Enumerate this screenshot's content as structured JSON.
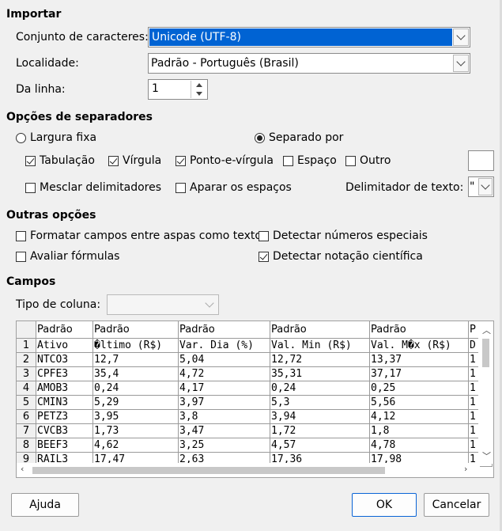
{
  "import": {
    "title": "Importar",
    "charset_label": "Conjunto de caracteres:",
    "charset_value": "Unicode (UTF-8)",
    "locale_label": "Localidade:",
    "locale_value": "Padrão - Português (Brasil)",
    "from_row_label": "Da linha:",
    "from_row_value": "1"
  },
  "separators": {
    "title": "Opções de separadores",
    "fixed_width": "Largura fixa",
    "separated_by": "Separado por",
    "tab": "Tabulação",
    "comma": "Vírgula",
    "semicolon": "Ponto-e-vírgula",
    "space": "Espaço",
    "other": "Outro",
    "merge": "Mesclar delimitadores",
    "trim": "Aparar os espaços",
    "text_delim_label": "Delimitador de texto:",
    "text_delim_value": "\""
  },
  "other": {
    "title": "Outras opções",
    "quoted_as_text": "Formatar campos entre aspas como texto",
    "detect_special": "Detectar números especiais",
    "eval_formulas": "Avaliar fórmulas",
    "detect_scientific": "Detectar notação científica"
  },
  "fields": {
    "title": "Campos",
    "column_type_label": "Tipo de coluna:",
    "column_type_value": "",
    "headers": [
      "Padrão",
      "Padrão",
      "Padrão",
      "Padrão",
      "Padrão",
      "P"
    ],
    "rows": [
      [
        "1",
        "Ativo",
        "�ltimo (R$)",
        "Var. Dia (%)",
        "Val. Min (R$)",
        "Val. M�x (R$)",
        "D"
      ],
      [
        "2",
        "NTCO3",
        "12,7",
        "5,04",
        "12,72",
        "13,37",
        "1"
      ],
      [
        "3",
        "CPFE3",
        "35,4",
        "4,72",
        "35,31",
        "37,17",
        "1"
      ],
      [
        "4",
        "AMOB3",
        "0,24",
        "4,17",
        "0,24",
        "0,25",
        "1"
      ],
      [
        "5",
        "CMIN3",
        "5,29",
        "3,97",
        "5,3",
        "5,56",
        "1"
      ],
      [
        "6",
        "PETZ3",
        "3,95",
        "3,8",
        "3,94",
        "4,12",
        "1"
      ],
      [
        "7",
        "CVCB3",
        "1,73",
        "3,47",
        "1,72",
        "1,8",
        "1"
      ],
      [
        "8",
        "BEEF3",
        "4,62",
        "3,25",
        "4,57",
        "4,78",
        "1"
      ],
      [
        "9",
        "RAIL3",
        "17,47",
        "2,63",
        "17,36",
        "17,98",
        "1"
      ]
    ]
  },
  "buttons": {
    "help": "Ajuda",
    "ok": "OK",
    "cancel": "Cancelar"
  },
  "colors": {
    "selection": "#0063d3",
    "default_button_border": "#0a64d6"
  }
}
